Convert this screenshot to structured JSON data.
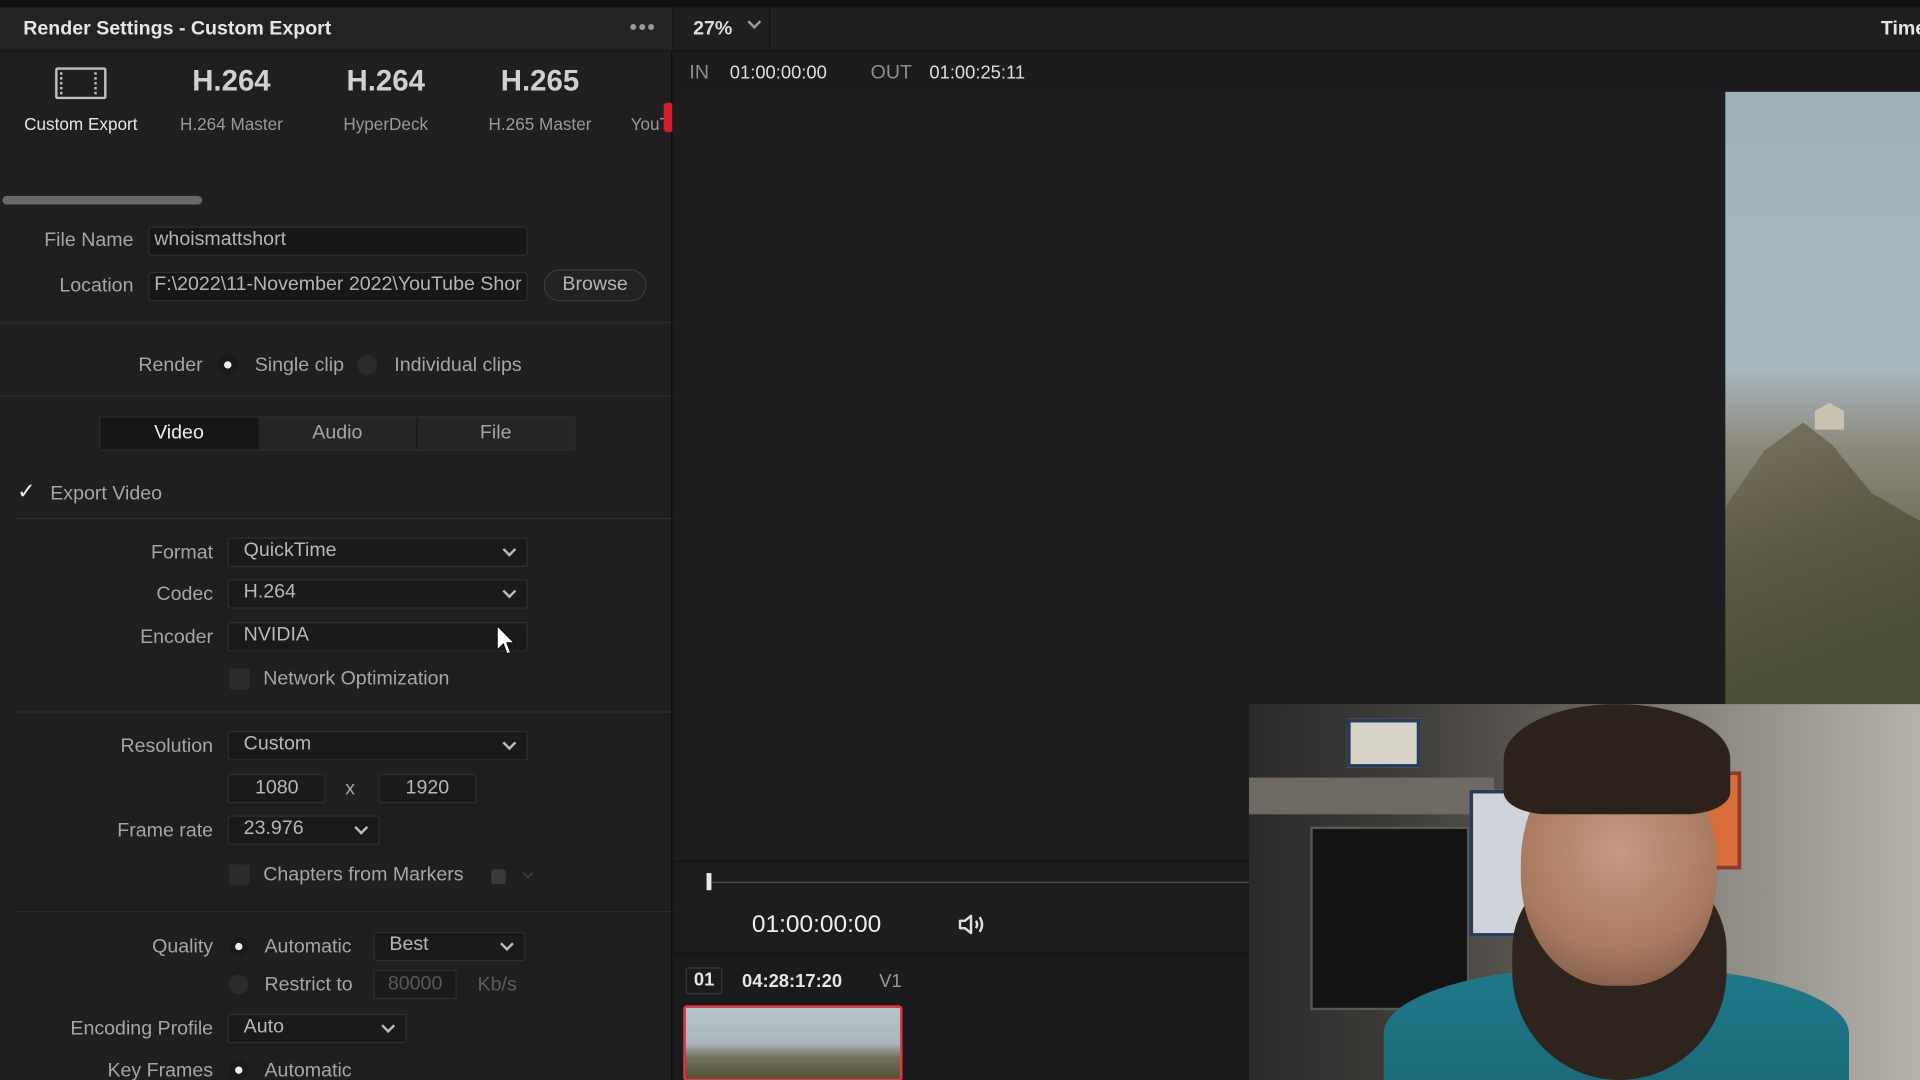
{
  "panel": {
    "title": "Render Settings - Custom Export",
    "more_icon": "more-horizontal-icon"
  },
  "presets": [
    {
      "big": "",
      "label": "Custom Export",
      "icon": "film-icon"
    },
    {
      "big": "H.264",
      "label": "H.264 Master"
    },
    {
      "big": "H.264",
      "label": "HyperDeck"
    },
    {
      "big": "H.265",
      "label": "H.265 Master"
    },
    {
      "big": "",
      "label": "YouTu"
    }
  ],
  "file": {
    "name_label": "File Name",
    "name_value": "whoismattshort",
    "location_label": "Location",
    "location_value": "F:\\2022\\11-November 2022\\YouTube Shor",
    "browse_label": "Browse"
  },
  "render": {
    "label": "Render",
    "single": "Single clip",
    "individual": "Individual clips",
    "selected": "single"
  },
  "tabs": [
    "Video",
    "Audio",
    "File"
  ],
  "video": {
    "export_video": "Export Video",
    "format_label": "Format",
    "format_value": "QuickTime",
    "codec_label": "Codec",
    "codec_value": "H.264",
    "encoder_label": "Encoder",
    "encoder_value": "NVIDIA",
    "network_opt": "Network Optimization",
    "resolution_label": "Resolution",
    "resolution_value": "Custom",
    "width": "1080",
    "x": "x",
    "height": "1920",
    "framerate_label": "Frame rate",
    "framerate_value": "23.976",
    "chapters": "Chapters from Markers",
    "quality_label": "Quality",
    "quality_auto": "Automatic",
    "quality_auto_value": "Best",
    "restrict_to": "Restrict to",
    "restrict_value": "80000",
    "restrict_unit": "Kb/s",
    "encoding_profile_label": "Encoding Profile",
    "encoding_profile_value": "Auto",
    "keyframes_label": "Key Frames",
    "keyframes_value": "Automatic"
  },
  "viewer": {
    "zoom": "27%",
    "timeline_label": "Timel",
    "in_label": "IN",
    "in_tc": "01:00:00:00",
    "out_label": "OUT",
    "out_tc": "01:00:25:11",
    "timecode": "01:00:00:00",
    "volume_icon": "speaker-icon"
  },
  "clip": {
    "number": "01",
    "timecode": "04:28:17:20",
    "track": "V1"
  },
  "colors": {
    "accent_red": "#e23a43",
    "panel_bg": "#1f1f21"
  }
}
